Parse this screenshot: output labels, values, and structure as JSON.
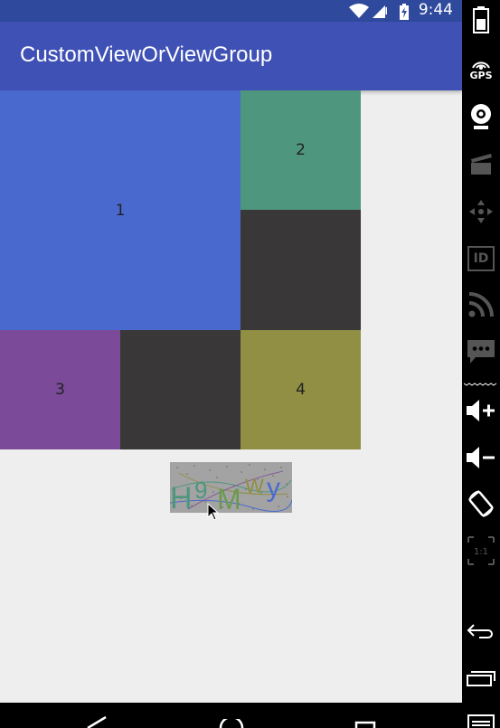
{
  "status_bar": {
    "time": "9:44"
  },
  "app_bar": {
    "title": "CustomViewOrViewGroup"
  },
  "grid": {
    "cells": [
      {
        "label": "1"
      },
      {
        "label": "2"
      },
      {
        "label": "3"
      },
      {
        "label": "4"
      }
    ]
  },
  "captcha": {
    "text": "H9MWy"
  },
  "emulator_panel": {
    "gps_label": "GPS",
    "id_label": "ID",
    "ratio_label": "1:1"
  },
  "colors": {
    "status_bar": "#2f4a9c",
    "app_bar": "#3f51b5",
    "cell_1": "#4a69cf",
    "cell_2": "#4e967e",
    "cell_dark": "#393738",
    "cell_3": "#7b4a98",
    "cell_4": "#908f44",
    "background": "#eeeeee"
  }
}
